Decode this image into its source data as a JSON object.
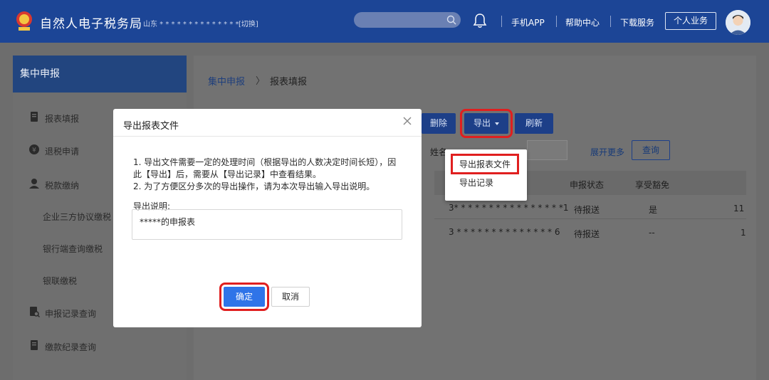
{
  "header": {
    "title": "自然人电子税务局",
    "region": "山东 * * * * * * * * * * * * * * ...",
    "switch_label": "[切换]",
    "nav": [
      "手机APP",
      "帮助中心",
      "下载服务"
    ],
    "personal_button": "个人业务",
    "brand_color": "#1c4596"
  },
  "sidebar": {
    "title": "集中申报",
    "items": [
      {
        "label": "报表填报",
        "icon": "document-icon"
      },
      {
        "label": "退税申请",
        "icon": "refund-icon"
      },
      {
        "label": "税款缴纳",
        "icon": "payment-icon"
      }
    ],
    "sub_items": [
      "企业三方协议缴税",
      "银行端查询缴税",
      "银联缴税"
    ],
    "bottom_items": [
      {
        "label": "申报记录查询",
        "icon": "record-search-icon"
      },
      {
        "label": "缴款纪录查询",
        "icon": "document-icon"
      }
    ]
  },
  "breadcrumb": {
    "root": "集中申报",
    "separator": "〉",
    "current": "报表填报"
  },
  "toolbar": {
    "delete": "删除",
    "export": "导出",
    "refresh": "刷新"
  },
  "filter": {
    "name_label": "姓名",
    "expand": "展开更多",
    "query": "查询"
  },
  "table": {
    "headers": [
      "申报状态",
      "享受豁免"
    ],
    "rows": [
      {
        "id": "3* * * * * * * * * * * * * * * *1",
        "status": "待报送",
        "exempt": "是",
        "extra": "11"
      },
      {
        "id": "3 * * * * * * * * * * * * * * 6",
        "status": "待报送",
        "exempt": "--",
        "extra": "1"
      }
    ]
  },
  "export_menu": {
    "items": [
      "导出报表文件",
      "导出记录"
    ]
  },
  "modal": {
    "title": "导出报表文件",
    "notes": [
      "1. 导出文件需要一定的处理时间（根据导出的人数决定时间长短），因",
      "此【导出】后，需要从【导出记录】中查看结果。",
      "2. 为了方便区分多次的导出操作，请为本次导出输入导出说明。"
    ],
    "desc_label": "导出说明:",
    "desc_value": "*****的申报表",
    "confirm": "确定",
    "cancel": "取消",
    "confirm_color": "#2f74e8",
    "highlight_color": "#e01f1f"
  }
}
